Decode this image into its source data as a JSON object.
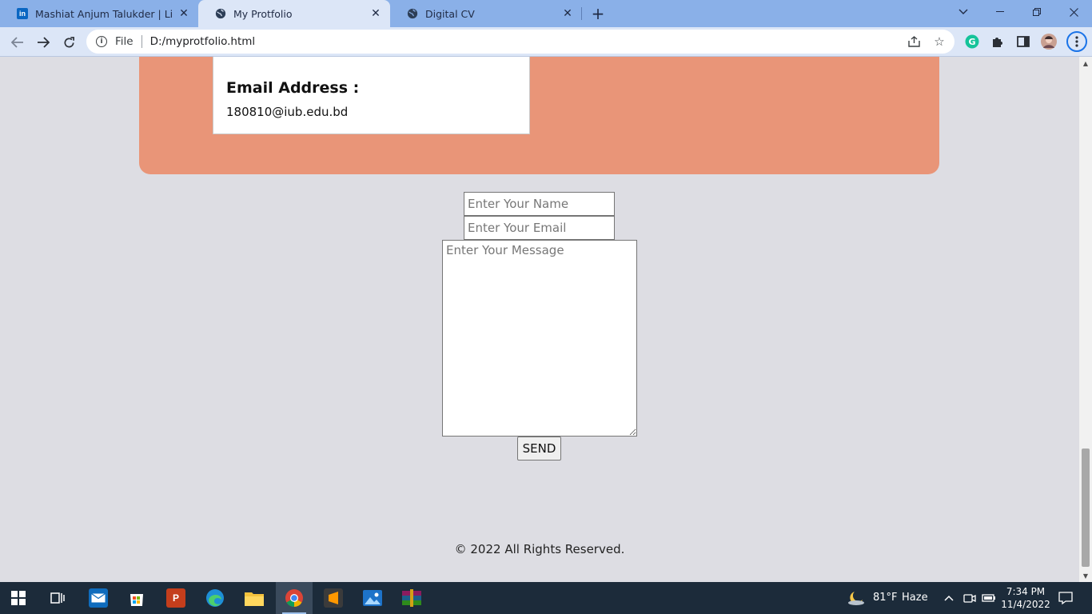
{
  "browser": {
    "tabs": [
      {
        "title": "Mashiat Anjum Talukder | LinkedIn",
        "favicon": "linkedin-icon",
        "active": false
      },
      {
        "title": "My Protfolio",
        "favicon": "globe-icon",
        "active": true
      },
      {
        "title": "Digital CV",
        "favicon": "globe-icon",
        "active": false
      }
    ],
    "scheme_label": "File",
    "url": "D:/myprotfolio.html"
  },
  "page": {
    "email_heading": "Email Address :",
    "email_value": "180810@iub.edu.bd",
    "form": {
      "name_placeholder": "Enter Your Name",
      "email_placeholder": "Enter Your Email",
      "message_placeholder": "Enter Your Message",
      "send_label": "SEND"
    },
    "footer": "© 2022 All Rights Reserved.",
    "colors": {
      "contact_card_bg": "#e99578",
      "page_bg": "#dddde3"
    }
  },
  "taskbar": {
    "apps": [
      "windows-start",
      "task-view",
      "mail",
      "microsoft-store",
      "powerpoint",
      "edge",
      "file-explorer",
      "chrome",
      "sublime-text",
      "photos",
      "winrar"
    ],
    "weather_temp": "81°F",
    "weather_desc": "Haze",
    "time": "7:34 PM",
    "date": "11/4/2022"
  }
}
